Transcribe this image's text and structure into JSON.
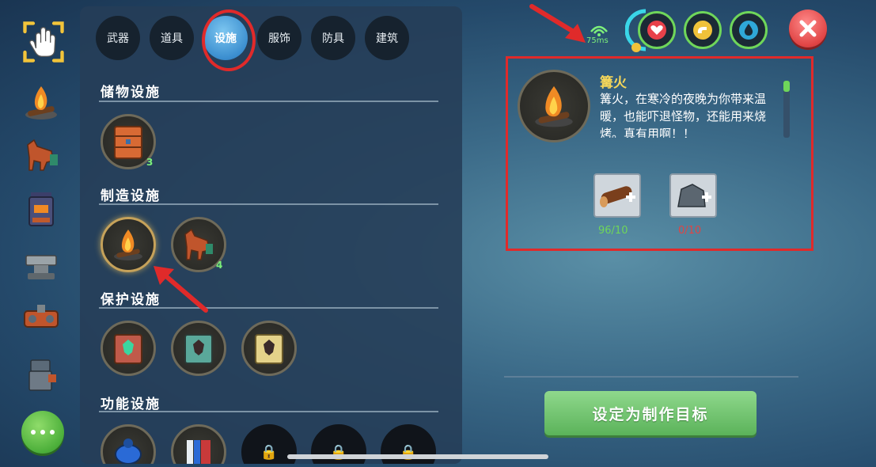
{
  "tabs": [
    {
      "label": "武器"
    },
    {
      "label": "道具"
    },
    {
      "label": "设施"
    },
    {
      "label": "服饰"
    },
    {
      "label": "防具"
    },
    {
      "label": "建筑"
    }
  ],
  "sections": [
    {
      "title": "储物设施",
      "items": [
        {
          "name": "storage-box",
          "count": "3"
        }
      ]
    },
    {
      "title": "制造设施",
      "items": [
        {
          "name": "campfire",
          "count": ""
        },
        {
          "name": "horse-workbench",
          "count": "4"
        }
      ]
    },
    {
      "title": "保护设施",
      "items": [
        {
          "name": "red-totem-box"
        },
        {
          "name": "teal-totem-box"
        },
        {
          "name": "yellow-totem-box"
        }
      ]
    },
    {
      "title": "功能设施",
      "items": [
        {
          "name": "blue-beetle"
        },
        {
          "name": "bookshelf"
        },
        {
          "name": "locked-1"
        },
        {
          "name": "locked-2"
        },
        {
          "name": "locked-3"
        }
      ]
    }
  ],
  "hud": {
    "ping": "75ms",
    "stats": [
      "heart-icon",
      "food-icon",
      "water-icon"
    ],
    "colors": {
      "health": "#e8414a",
      "food": "#f0c23a",
      "water": "#2fa8d8",
      "ping": "#7df07a"
    }
  },
  "detail": {
    "name": "篝火",
    "description": "篝火，在寒冷的夜晚为你带来温暖，也能吓退怪物，还能用来烧烤。真有用啊！！",
    "materials": [
      {
        "icon": "wood-log-icon",
        "count": "96/10",
        "color": "#6fd65a"
      },
      {
        "icon": "stone-icon",
        "count": "0/10",
        "color": "#e04444"
      }
    ]
  },
  "action_button": "设定为制作目标"
}
